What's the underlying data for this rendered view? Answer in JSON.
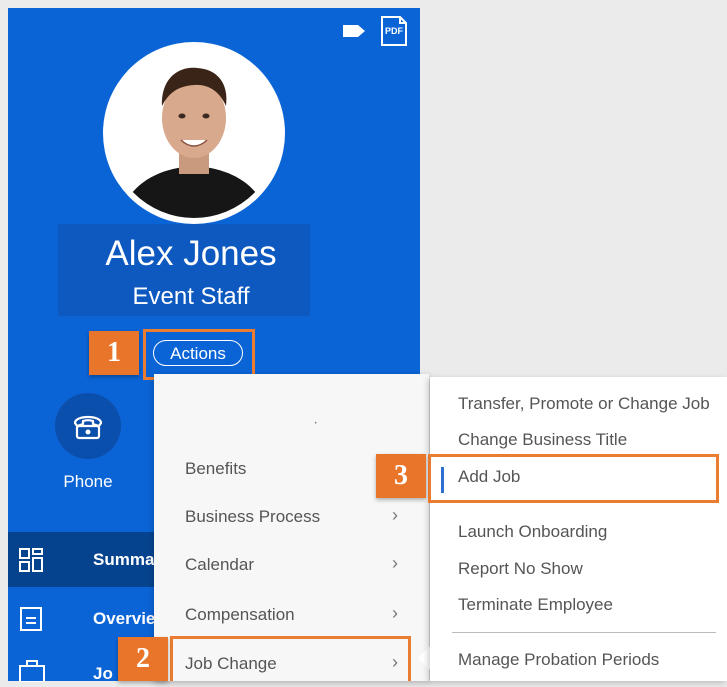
{
  "profile": {
    "name": "Alex Jones",
    "title": "Event Staff",
    "actions_label": "Actions",
    "phone_label": "Phone",
    "pdf_label": "PDF"
  },
  "nav": {
    "summary_label": "Summa",
    "overview_label": "Overvie",
    "job_label": "Jo"
  },
  "actions_menu": {
    "dot": "·",
    "items": [
      {
        "label": "Benefits",
        "chevron": ""
      },
      {
        "label": "Business Process",
        "chevron": "›"
      },
      {
        "label": "Calendar",
        "chevron": "›"
      },
      {
        "label": "Compensation",
        "chevron": "›"
      },
      {
        "label": "Job Change",
        "chevron": "›"
      }
    ]
  },
  "submenu": {
    "items": [
      {
        "label": "Transfer, Promote or Change Job"
      },
      {
        "label": "Change Business Title"
      },
      {
        "label": "Add Job"
      },
      {
        "label": "Launch Onboarding"
      },
      {
        "label": "Report No Show"
      },
      {
        "label": "Terminate Employee"
      },
      {
        "label": "Manage Probation Periods"
      }
    ]
  },
  "callouts": {
    "step1": "1",
    "step2": "2",
    "step3": "3"
  },
  "colors": {
    "panel_blue": "#0b64d6",
    "callout_orange": "#ea7d31",
    "active_blue": "#2d6fd2"
  }
}
